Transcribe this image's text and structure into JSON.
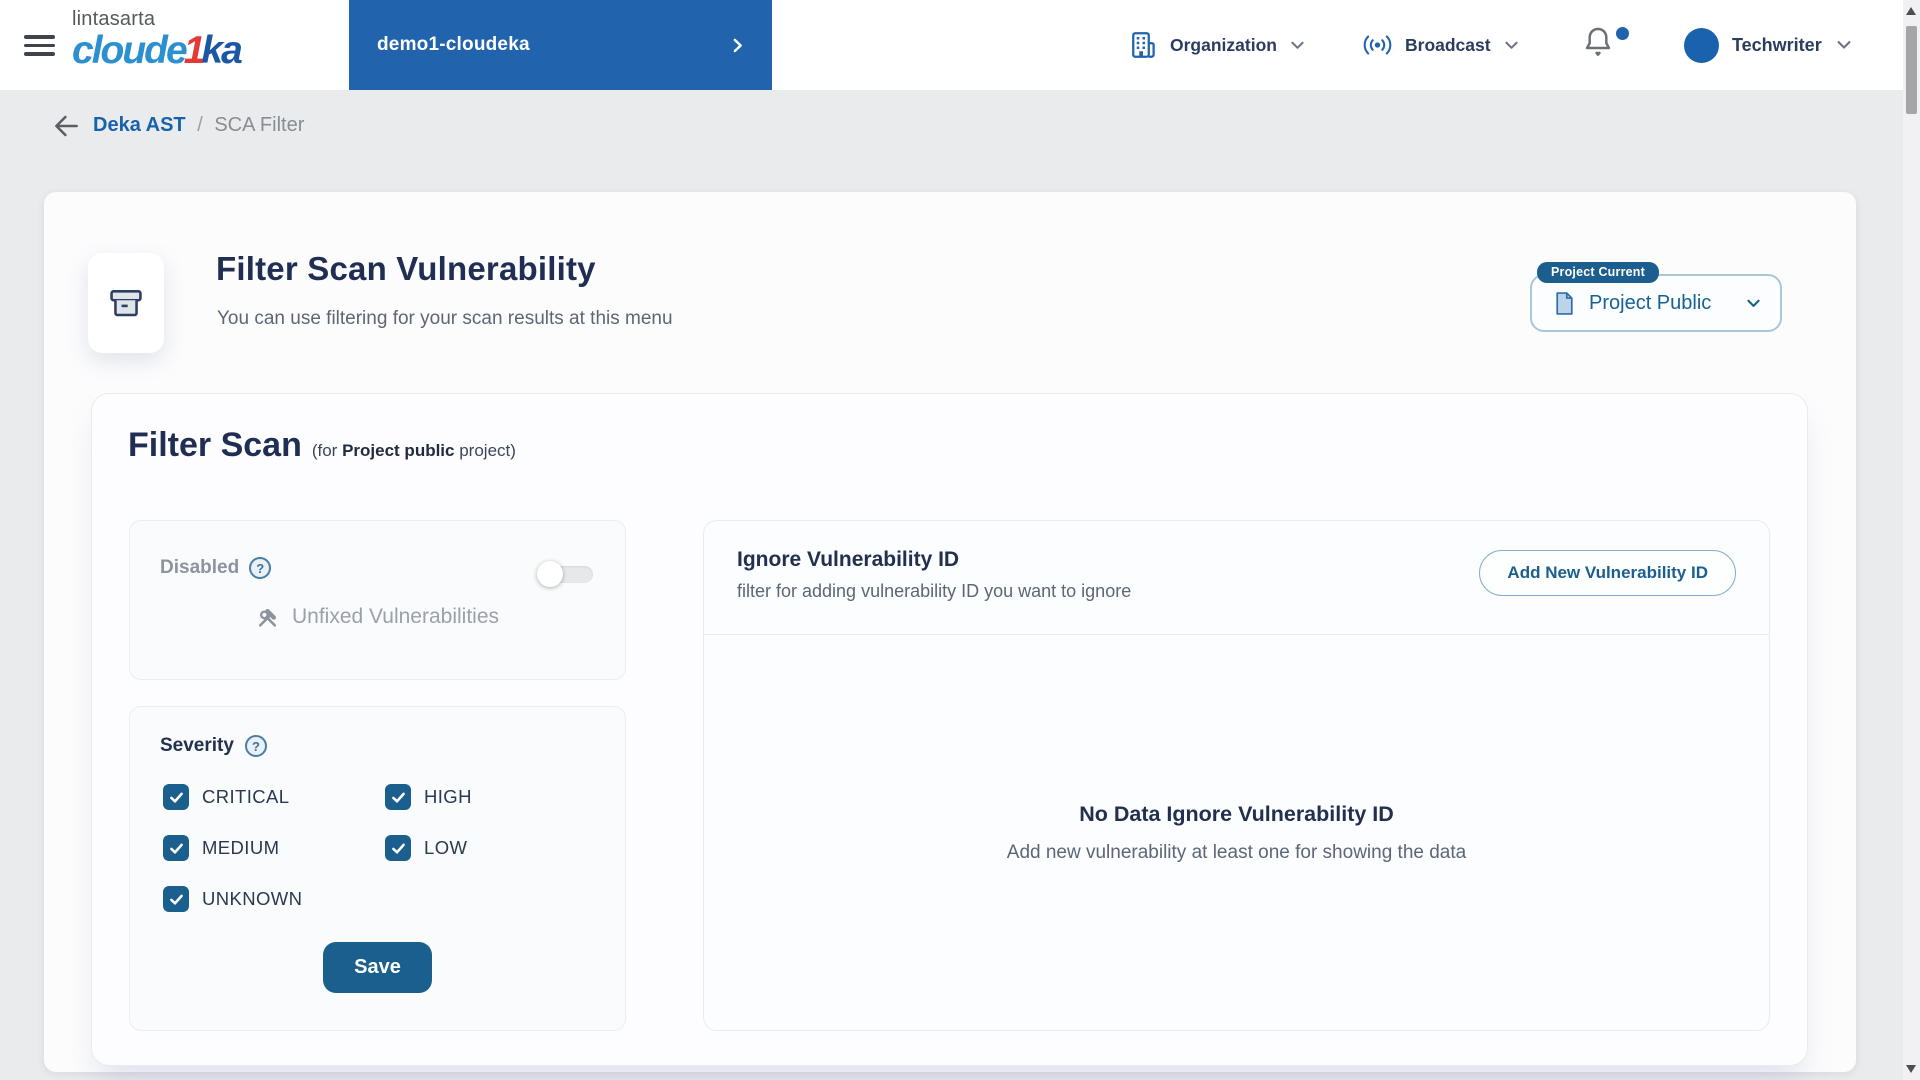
{
  "header": {
    "brand": {
      "top": "lintasarta",
      "parts": [
        "cloude",
        "1",
        "ka"
      ]
    },
    "workspace": {
      "label": "demo1-cloudeka"
    },
    "menus": {
      "organization": "Organization",
      "broadcast": "Broadcast"
    },
    "user": {
      "name": "Techwriter"
    }
  },
  "breadcrumb": {
    "link": "Deka AST",
    "separator": "/",
    "current": "SCA Filter"
  },
  "page": {
    "title": "Filter Scan Vulnerability",
    "subtitle": "You can use filtering for your scan results at this menu",
    "project_badge": "Project Current",
    "project_selected": "Project Public"
  },
  "filter_scan": {
    "heading": "Filter Scan",
    "note": {
      "prefix": "(for ",
      "bold": "Project public",
      "suffix": " project)"
    },
    "disabled_panel": {
      "label": "Disabled",
      "help": "?",
      "row_label": "Unfixed Vulnerabilities",
      "toggle_on": false
    },
    "severity_panel": {
      "label": "Severity",
      "help": "?",
      "options": [
        {
          "label": "CRITICAL",
          "checked": true
        },
        {
          "label": "HIGH",
          "checked": true
        },
        {
          "label": "MEDIUM",
          "checked": true
        },
        {
          "label": "LOW",
          "checked": true
        },
        {
          "label": "UNKNOWN",
          "checked": true
        }
      ],
      "save_label": "Save"
    },
    "ignore_panel": {
      "title": "Ignore Vulnerability ID",
      "subtitle": "filter for adding vulnerability ID you want to ignore",
      "add_button": "Add New Vulnerability ID",
      "empty_title": "No Data Ignore Vulnerability ID",
      "empty_subtitle": "Add new vulnerability at least one for showing the data"
    }
  },
  "icons": {
    "hamburger": "menu",
    "organization": "building",
    "broadcast": "radio-waves",
    "notifications": "bell",
    "workspace_arrow": "chevron-right",
    "back": "arrow-left",
    "page": "archive-box",
    "project": "document",
    "help": "question-circle",
    "unfixed": "crossed-tools",
    "checked": "checkmark"
  },
  "colors": {
    "header_band": "#2163ad",
    "accent_blue": "#1563ac",
    "deep_blue": "#1a5f8e",
    "navy_text": "#22304e",
    "muted_text": "#5d6675",
    "badge": "#1c5f8e",
    "logo_red": "#e53935",
    "page_bg": "#eaebed"
  }
}
